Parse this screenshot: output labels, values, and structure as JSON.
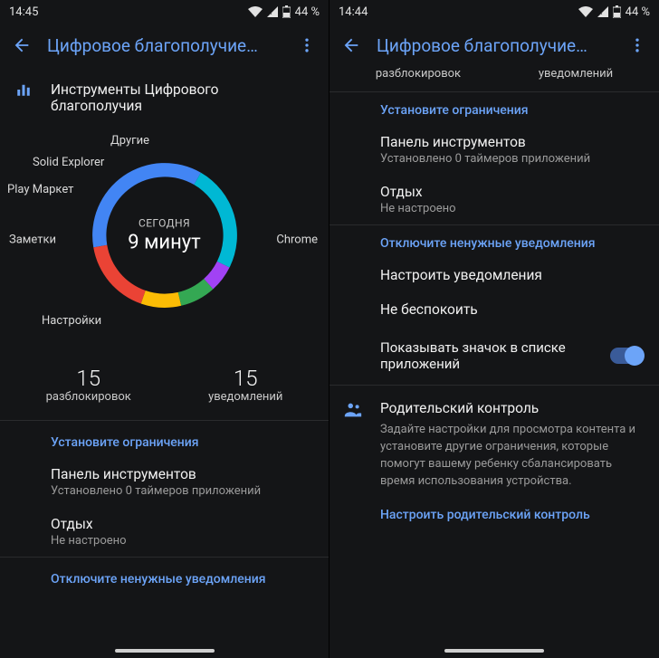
{
  "left": {
    "status_time": "14:45",
    "battery_text": "44 %",
    "title": "Цифровое благополучие…",
    "tools_heading": "Инструменты Цифрового благополучия",
    "chart_center_small": "СЕГОДНЯ",
    "chart_center_big": "9 минут",
    "chart_labels": {
      "chrome": "Chrome",
      "settings": "Настройки",
      "notes": "Заметки",
      "play": "Play Маркет",
      "solid": "Solid Explorer",
      "other": "Другие"
    },
    "stats": {
      "unlocks_num": "15",
      "unlocks_label": "разблокировок",
      "notifs_num": "15",
      "notifs_label": "уведомлений"
    },
    "limits_header": "Установите ограничения",
    "dashboard_title": "Панель инструментов",
    "dashboard_sub": "Установлено 0 таймеров приложений",
    "winddown_title": "Отдых",
    "winddown_sub": "Не настроено",
    "disable_notifs_header": "Отключите ненужные уведомления"
  },
  "right": {
    "status_time": "14:44",
    "battery_text": "44 %",
    "title": "Цифровое благополучие…",
    "peek_unlocks": "разблокировок",
    "peek_notifs": "уведомлений",
    "limits_header": "Установите ограничения",
    "dashboard_title": "Панель инструментов",
    "dashboard_sub": "Установлено 0 таймеров приложений",
    "winddown_title": "Отдых",
    "winddown_sub": "Не настроено",
    "disable_notifs_header": "Отключите ненужные уведомления",
    "manage_notifs": "Настроить уведомления",
    "dnd": "Не беспокоить",
    "show_icon": "Показывать значок в списке приложений",
    "parental_title": "Родительский контроль",
    "parental_desc": "Задайте настройки для просмотра контента и установите другие ограничения, которые помогут вашему ребенку сбалансировать время использования устройства.",
    "parental_link": "Настроить родительский контроль"
  },
  "chart_data": {
    "type": "pie",
    "title": "СЕГОДНЯ — 9 минут",
    "series": [
      {
        "name": "Chrome",
        "color": "#4285F4",
        "fraction": 0.36
      },
      {
        "name": "Настройки",
        "color": "#EA4335",
        "fraction": 0.17
      },
      {
        "name": "Заметки",
        "color": "#FBBC05",
        "fraction": 0.09
      },
      {
        "name": "Play Маркет",
        "color": "#34A853",
        "fraction": 0.08
      },
      {
        "name": "Solid Explorer",
        "color": "#A142F4",
        "fraction": 0.06
      },
      {
        "name": "Другие",
        "color": "#00B8D4",
        "fraction": 0.24
      }
    ],
    "center_label_top": "СЕГОДНЯ",
    "center_label_bottom": "9 минут"
  }
}
